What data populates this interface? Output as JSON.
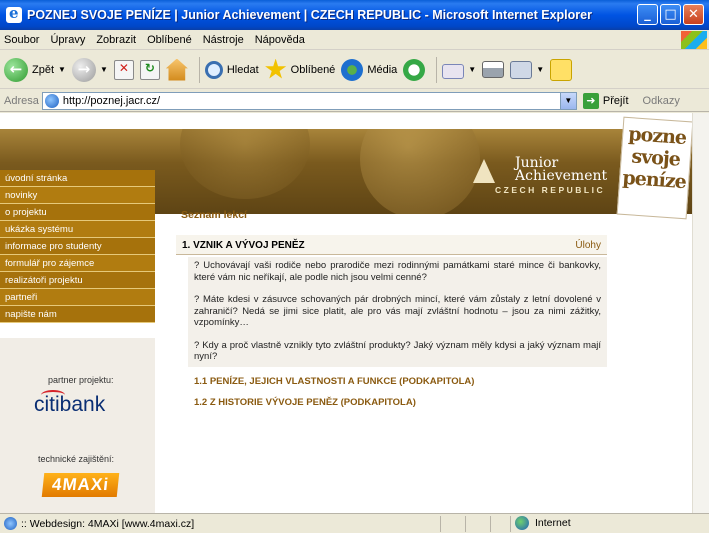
{
  "window": {
    "title": "POZNEJ SVOJE PENÍZE | Junior Achievement | CZECH REPUBLIC - Microsoft Internet Explorer",
    "min": "_",
    "max": "□",
    "close": "✕"
  },
  "menu": [
    "Soubor",
    "Úpravy",
    "Zobrazit",
    "Oblíbené",
    "Nástroje",
    "Nápověda"
  ],
  "toolbar": {
    "back": "Zpět",
    "search": "Hledat",
    "favorites": "Oblíbené",
    "media": "Média"
  },
  "address": {
    "label": "Adresa",
    "url": "http://poznej.jacr.cz/",
    "go": "Přejít",
    "links": "Odkazy"
  },
  "site": {
    "nav": [
      "úvodní stránka",
      "novinky",
      "o projektu",
      "ukázka systému",
      "informace pro studenty",
      "formulář pro zájemce",
      "realizátoři projektu",
      "partneři",
      "napište nám"
    ],
    "logo_line1": "Junior",
    "logo_line2": "Achievement",
    "logo_sub": "CZECH REPUBLIC",
    "stamp": [
      "pozne",
      "svoje",
      "peníze"
    ],
    "partner_label": "partner projektu:",
    "partner_logo": "citibank",
    "tech_label": "technické zajištění:",
    "tech_logo": "4MAXi"
  },
  "content": {
    "section_title": "Seznam lekcí",
    "lesson_title": "1. VZNIK A VÝVOJ PENĚZ",
    "tasks_link": "Úlohy",
    "questions": [
      "? Uchovávají vaši rodiče nebo prarodiče mezi rodinnými památkami staré mince či bankovky, které vám nic neříkají, ale podle nich jsou velmi cenné?",
      "? Máte kdesi v zásuvce schovaných pár drobných mincí, které vám zůstaly z letní dovolené v zahraničí? Nedá se jimi sice platit, ale pro vás mají zvláštní hodnotu – jsou za nimi zážitky, vzpomínky…",
      "? Kdy a proč vlastně vznikly tyto zvláštní produkty? Jaký význam měly kdysi a jaký význam mají nyní?"
    ],
    "subchapter1": "1.1 PENÍZE, JEJICH VLASTNOSTI A FUNKCE (PODKAPITOLA)",
    "subchapter2": "1.2 Z HISTORIE VÝVOJE PENĚZ (PODKAPITOLA)"
  },
  "status": {
    "text": ":: Webdesign: 4MAXi [www.4maxi.cz]",
    "zone": "Internet"
  }
}
